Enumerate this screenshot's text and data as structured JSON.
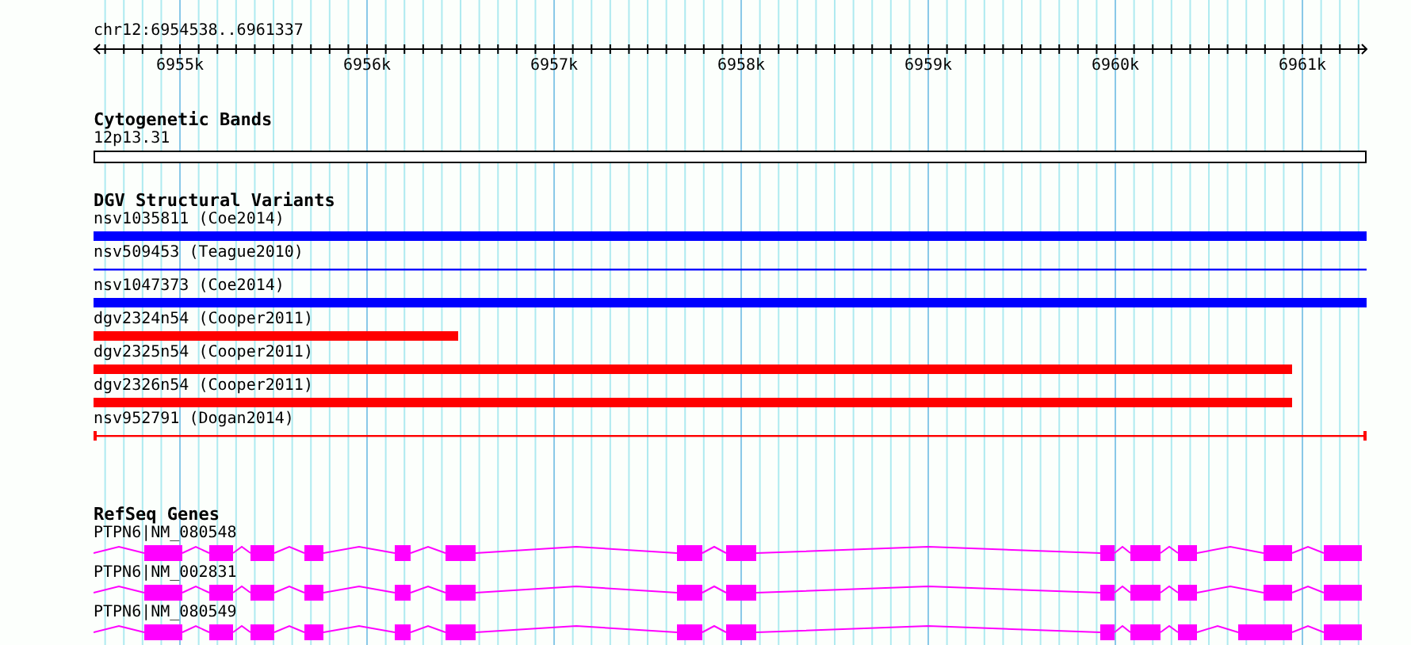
{
  "ruler": {
    "title": "chr12:6954538..6961337",
    "tick_labels": [
      "6955k",
      "6956k",
      "6957k",
      "6958k",
      "6959k",
      "6960k",
      "6961k"
    ]
  },
  "cytogenetic_bands": {
    "title": "Cytogenetic Bands",
    "features": [
      {
        "label": "12p13.31"
      }
    ]
  },
  "dgv_structural_variants": {
    "title": "DGV Structural Variants",
    "features": [
      {
        "label": "nsv1035811 (Coe2014)",
        "color": "#0000ff",
        "kind": "bar"
      },
      {
        "label": "nsv509453 (Teague2010)",
        "color": "#0000ff",
        "kind": "line"
      },
      {
        "label": "nsv1047373 (Coe2014)",
        "color": "#0000ff",
        "kind": "bar"
      },
      {
        "label": "dgv2324n54 (Cooper2011)",
        "color": "#ff0000",
        "kind": "bar"
      },
      {
        "label": "dgv2325n54 (Cooper2011)",
        "color": "#ff0000",
        "kind": "bar"
      },
      {
        "label": "dgv2326n54 (Cooper2011)",
        "color": "#ff0000",
        "kind": "bar"
      },
      {
        "label": "nsv952791 (Dogan2014)",
        "color": "#ff0000",
        "kind": "line"
      }
    ]
  },
  "refseq_genes": {
    "title": "RefSeq Genes",
    "features": [
      {
        "label": "PTPN6|NM_080548"
      },
      {
        "label": "PTPN6|NM_002831"
      },
      {
        "label": "PTPN6|NM_080549"
      }
    ]
  }
}
